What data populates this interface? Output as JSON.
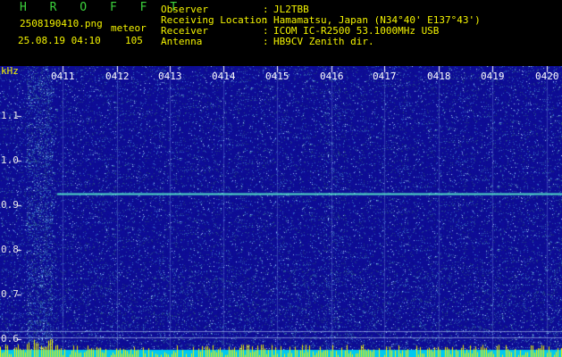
{
  "header": {
    "title": "H R O F F T",
    "filename": "2508190410.png",
    "datetime": "25.08.19 04:10",
    "mode_label": "meteor",
    "count": "105",
    "fields": [
      {
        "label": "Observer",
        "value": "JL2TBB"
      },
      {
        "label": "Receiving Location",
        "value": "Hamamatsu, Japan (N34°40' E137°43')"
      },
      {
        "label": "Receiver",
        "value": "ICOM IC-R2500 53.1000MHz USB"
      },
      {
        "label": "Antenna",
        "value": "HB9CV Zenith dir."
      }
    ]
  },
  "spectrogram": {
    "unit": "kHz",
    "time_labels": [
      "0411",
      "0412",
      "0413",
      "0414",
      "0415",
      "0416",
      "0417",
      "0418",
      "0419",
      "0420"
    ],
    "freq_labels": [
      "1.1",
      "1.0",
      "0.9",
      "0.8",
      "0.7",
      "0.6"
    ],
    "carrier_khz": 0.925,
    "colors": {
      "background": "#0c0c8c",
      "noise": "#3c78dc",
      "carrier": "#50dcc8",
      "baseline": "#00c8f0",
      "spikes": "#f0f000",
      "tick_lines": "#ffffff"
    }
  }
}
